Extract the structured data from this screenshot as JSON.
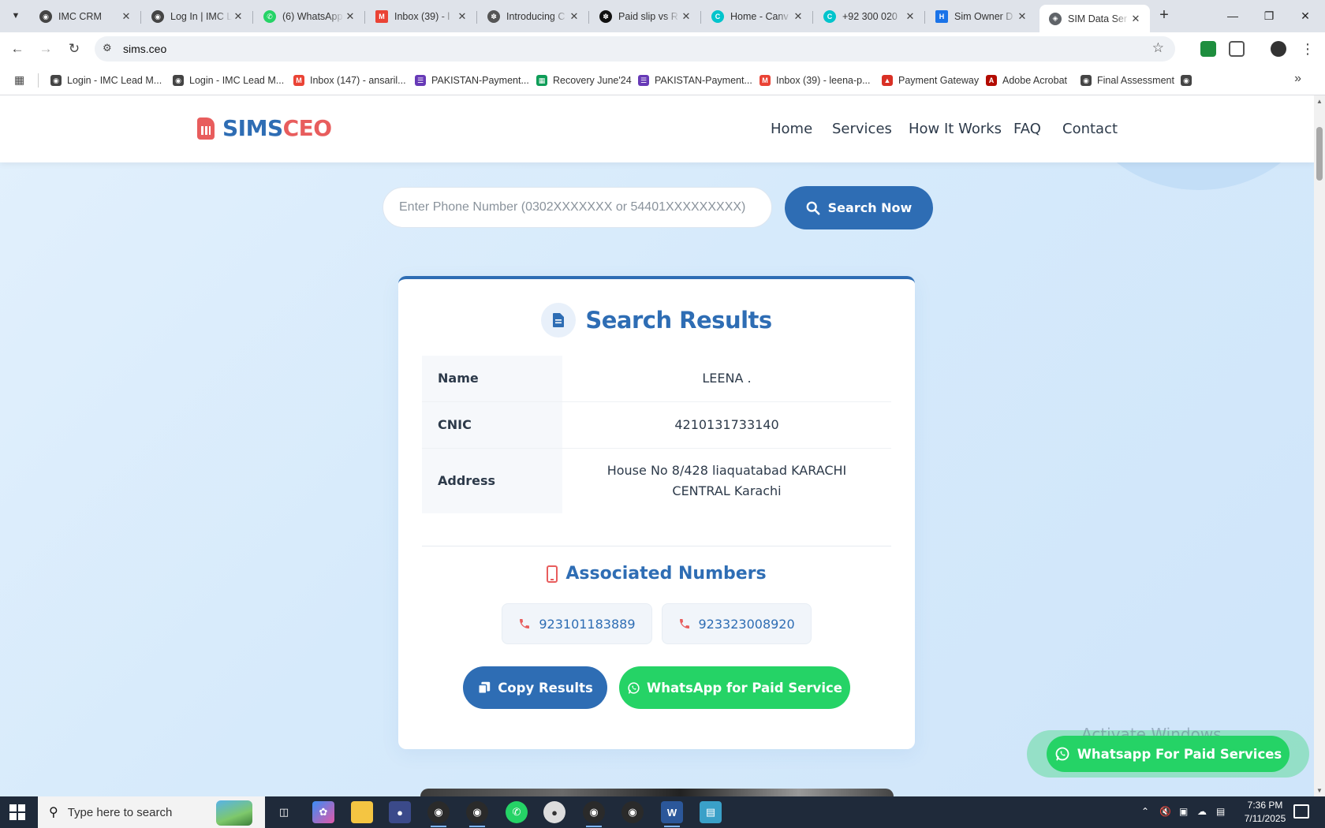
{
  "browser": {
    "tabs": [
      {
        "title": "IMC CRM",
        "color": "#444444"
      },
      {
        "title": "Log In | IMC L",
        "color": "#444444"
      },
      {
        "title": "(6) WhatsApp",
        "color": "#25d366"
      },
      {
        "title": "Inbox (39) - l",
        "color": "#ea4335"
      },
      {
        "title": "Introducing C",
        "color": "#555555"
      },
      {
        "title": "Paid slip vs R",
        "color": "#111111"
      },
      {
        "title": "Home - Canv",
        "color": "#00c4cc"
      },
      {
        "title": "+92 300 020",
        "color": "#00c4cc"
      },
      {
        "title": "Sim Owner D",
        "color": "#1a73e8"
      },
      {
        "title": "SIM Data Ser",
        "color": "#5f6368"
      }
    ],
    "url": "sims.ceo",
    "bookmarks": [
      {
        "label": "Login - IMC Lead M...",
        "color": "#444444"
      },
      {
        "label": "Login - IMC Lead M...",
        "color": "#444444"
      },
      {
        "label": "Inbox (147) - ansaril...",
        "color": "#ea4335"
      },
      {
        "label": "PAKISTAN-Payment...",
        "color": "#673ab7"
      },
      {
        "label": "Recovery June'24",
        "color": "#0f9d58"
      },
      {
        "label": "PAKISTAN-Payment...",
        "color": "#673ab7"
      },
      {
        "label": "Inbox (39) - leena-p...",
        "color": "#ea4335"
      },
      {
        "label": "Payment Gateway",
        "color": "#d93025"
      },
      {
        "label": "Adobe Acrobat",
        "color": "#b30b00"
      },
      {
        "label": "Final Assessment",
        "color": "#444444"
      }
    ]
  },
  "site": {
    "logo_part1": "SIMS",
    "logo_part2": "CEO",
    "nav": [
      "Home",
      "Services",
      "How It Works",
      "FAQ",
      "Contact"
    ],
    "search_placeholder": "Enter Phone Number (0302XXXXXXX or 54401XXXXXXXXX)",
    "search_button": "Search Now"
  },
  "results": {
    "title": "Search Results",
    "rows": [
      {
        "label": "Name",
        "value": "LEENA ."
      },
      {
        "label": "CNIC",
        "value": "4210131733140"
      },
      {
        "label": "Address",
        "value": "House No 8/428 liaquatabad KARACHI CENTRAL Karachi"
      }
    ],
    "associated_title": "Associated Numbers",
    "numbers": [
      "923101183889",
      "923323008920"
    ],
    "copy_button": "Copy Results",
    "whatsapp_button": "WhatsApp for Paid Service"
  },
  "floating_button": "Whatsapp For Paid Services",
  "watermark": "Activate Windows",
  "taskbar": {
    "search_placeholder": "Type here to search",
    "time": "7:36 PM",
    "date": "7/11/2025"
  },
  "colors": {
    "primary": "#2e6db4",
    "accent_red": "#e85d5d",
    "whatsapp_green": "#25d366"
  }
}
